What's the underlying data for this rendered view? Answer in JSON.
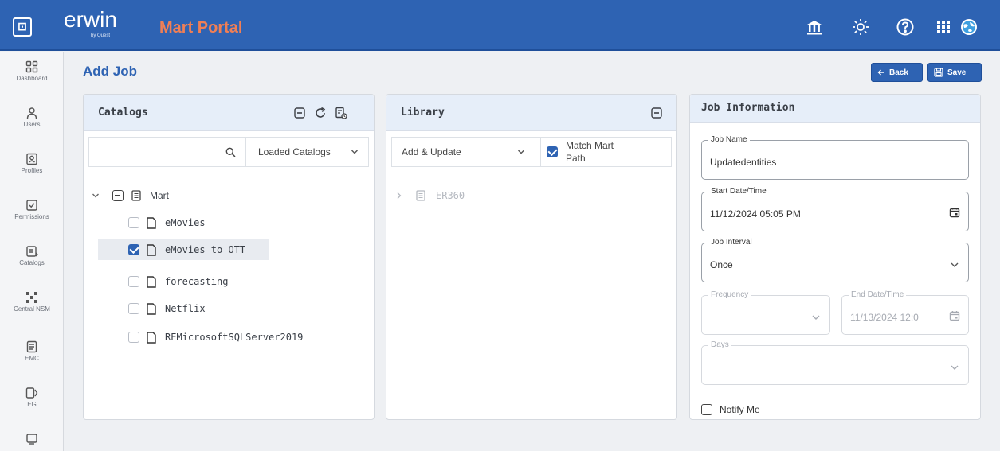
{
  "topbar": {
    "logo_text": "erwin",
    "logo_subtext": "by Quest",
    "portal_title": "Mart Portal",
    "icons": [
      "app-menu-icon",
      "bank-icon",
      "sun-icon",
      "help-icon",
      "grid-apps-icon",
      "globe-icon"
    ]
  },
  "nav": {
    "items": [
      {
        "label": "Dashboard",
        "icon": "dashboard-icon"
      },
      {
        "label": "Users",
        "icon": "user-icon"
      },
      {
        "label": "Profiles",
        "icon": "profile-icon"
      },
      {
        "label": "Permissions",
        "icon": "permissions-icon"
      },
      {
        "label": "Catalogs",
        "icon": "catalogs-icon"
      },
      {
        "label": "Central NSM",
        "icon": "central-nsm-icon"
      },
      {
        "label": "EMC",
        "icon": "emc-icon"
      },
      {
        "label": "EG",
        "icon": "eg-icon"
      }
    ]
  },
  "header": {
    "title": "Add Job",
    "back_label": "Back",
    "save_label": "Save"
  },
  "catalogs": {
    "title": "Catalogs",
    "search_placeholder": "",
    "filter_value": "Loaded Catalogs",
    "root": "Mart",
    "items": [
      {
        "label": "eMovies",
        "checked": false
      },
      {
        "label": "eMovies_to_OTT",
        "checked": true
      },
      {
        "label": "forecasting",
        "checked": false
      },
      {
        "label": "Netflix",
        "checked": false
      },
      {
        "label": "REMicrosoftSQLServer2019",
        "checked": false
      }
    ]
  },
  "library": {
    "title": "Library",
    "action_value": "Add & Update",
    "match_label": "Match Mart Path",
    "match_checked": true,
    "tree": [
      "ER360"
    ]
  },
  "job": {
    "title": "Job Information",
    "name_label": "Job Name",
    "name_value": "Updatedentities",
    "start_label": "Start Date/Time",
    "start_value": "11/12/2024 05:05 PM",
    "interval_label": "Job Interval",
    "interval_value": "Once",
    "frequency_label": "Frequency",
    "frequency_value": "",
    "end_label": "End Date/Time",
    "end_value": "11/13/2024 12:0",
    "days_label": "Days",
    "days_value": "",
    "notify_label": "Notify Me",
    "notify_checked": false
  },
  "colors": {
    "brand": "#2e63b3",
    "accent": "#f07f55"
  }
}
